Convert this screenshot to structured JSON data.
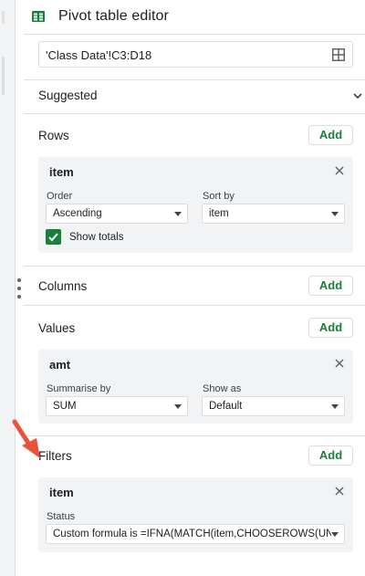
{
  "header": {
    "title": "Pivot table editor"
  },
  "range": {
    "value": "'Class Data'!C3:D18"
  },
  "sections": {
    "suggested": "Suggested",
    "rows": "Rows",
    "columns": "Columns",
    "values": "Values",
    "filters": "Filters"
  },
  "buttons": {
    "add": "Add"
  },
  "rows_card": {
    "field": "item",
    "order_label": "Order",
    "order_value": "Ascending",
    "sortby_label": "Sort by",
    "sortby_value": "item",
    "show_totals": "Show totals",
    "show_totals_checked": true
  },
  "values_card": {
    "field": "amt",
    "summarise_label": "Summarise by",
    "summarise_value": "SUM",
    "showas_label": "Show as",
    "showas_value": "Default"
  },
  "filters_card": {
    "field": "item",
    "status_label": "Status",
    "status_value": "Custom formula is =IFNA(MATCH(item,CHOOSEROWS(UNIQU..."
  },
  "colors": {
    "accent": "#188038",
    "annotation_arrow": "#e8533a"
  },
  "icons": [
    "sheets-icon",
    "grid-select-icon",
    "chevron-down-icon",
    "close-icon",
    "check-icon",
    "drag-handle-icon"
  ]
}
